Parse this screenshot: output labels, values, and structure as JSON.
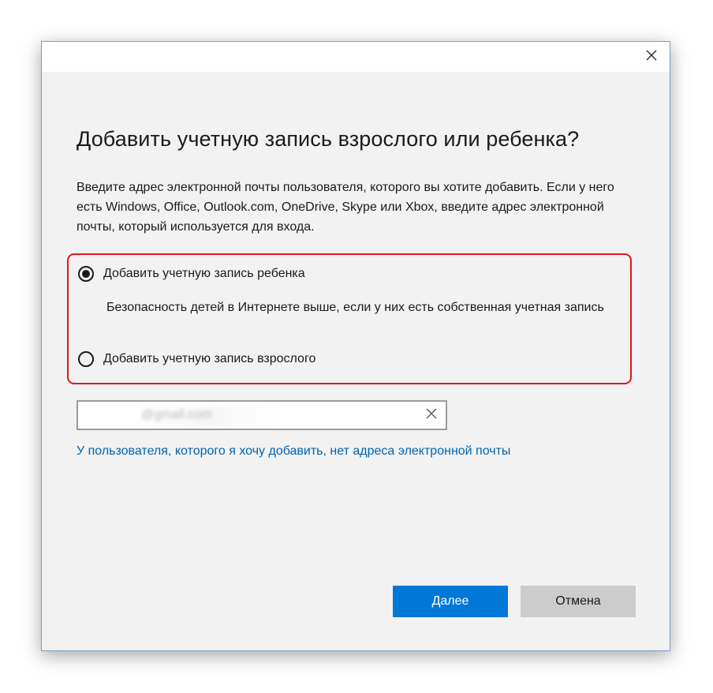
{
  "dialog": {
    "heading": "Добавить учетную запись взрослого или ребенка?",
    "description": "Введите адрес электронной почты пользователя, которого вы хотите добавить. Если у него есть Windows, Office, Outlook.com, OneDrive, Skype или Xbox, введите адрес электронной почты, который используется для входа.",
    "options": [
      {
        "label": "Добавить учетную запись ребенка",
        "selected": true,
        "sublabel": "Безопасность детей в Интернете выше, если у них есть собственная учетная запись"
      },
      {
        "label": "Добавить учетную запись взрослого",
        "selected": false
      }
    ],
    "email": {
      "value": "@gmail.com"
    },
    "no_email_link": "У пользователя, которого я хочу добавить, нет адреса электронной почты",
    "buttons": {
      "next": "Далее",
      "cancel": "Отмена"
    }
  },
  "icons": {
    "close": "close-icon",
    "clear": "clear-icon"
  },
  "colors": {
    "accent": "#0078d7",
    "link": "#0063b1",
    "highlight_border": "#e0161e",
    "dialog_bg": "#f2f2f2"
  }
}
